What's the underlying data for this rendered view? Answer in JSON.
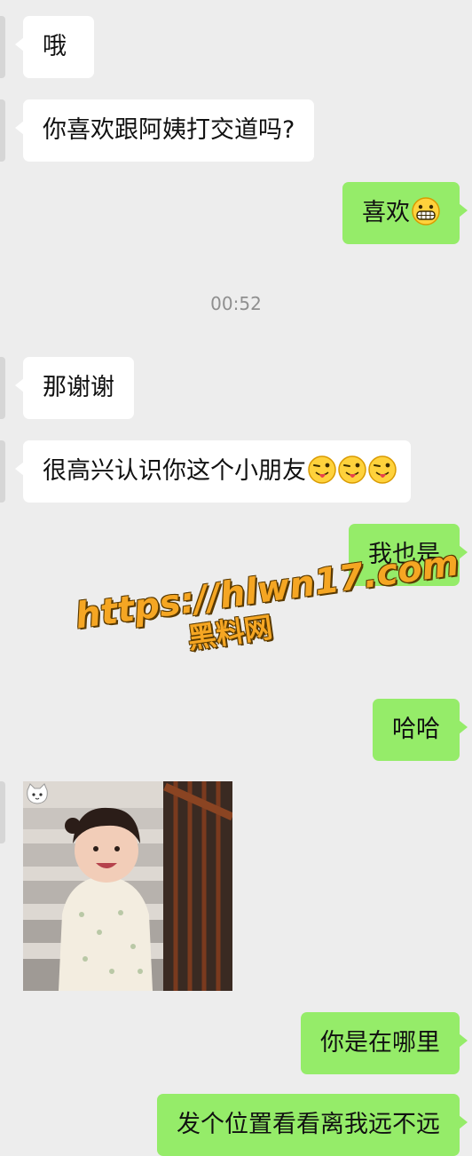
{
  "timestamp": "00:52",
  "messages": [
    {
      "id": "m1",
      "side": "in",
      "text": "哦"
    },
    {
      "id": "m2",
      "side": "in",
      "text": "你喜欢跟阿姨打交道吗?"
    },
    {
      "id": "m3",
      "side": "out",
      "text": "喜欢",
      "emoji": [
        "grin-icon"
      ]
    },
    {
      "id": "m4",
      "side": "in",
      "text": "那谢谢"
    },
    {
      "id": "m5",
      "side": "in",
      "text": "很高兴认识你这个小朋友",
      "emoji": [
        "wink-tongue-icon",
        "wink-tongue-icon",
        "wink-tongue-icon"
      ]
    },
    {
      "id": "m6",
      "side": "out",
      "text": "我也是"
    },
    {
      "id": "m7",
      "side": "out",
      "text": "哈哈"
    },
    {
      "id": "m8",
      "side": "in",
      "type": "image",
      "icon": "cat-face-icon"
    },
    {
      "id": "m9",
      "side": "out",
      "text": "你是在哪里"
    },
    {
      "id": "m10",
      "side": "out",
      "text": "发个位置看看离我远不远"
    }
  ],
  "watermark": {
    "url": "https://hlwn17.com",
    "brand": "黑料网"
  },
  "colors": {
    "background": "#ededed",
    "incoming": "#ffffff",
    "outgoing": "#95ec69",
    "watermark": "#f5a623"
  }
}
